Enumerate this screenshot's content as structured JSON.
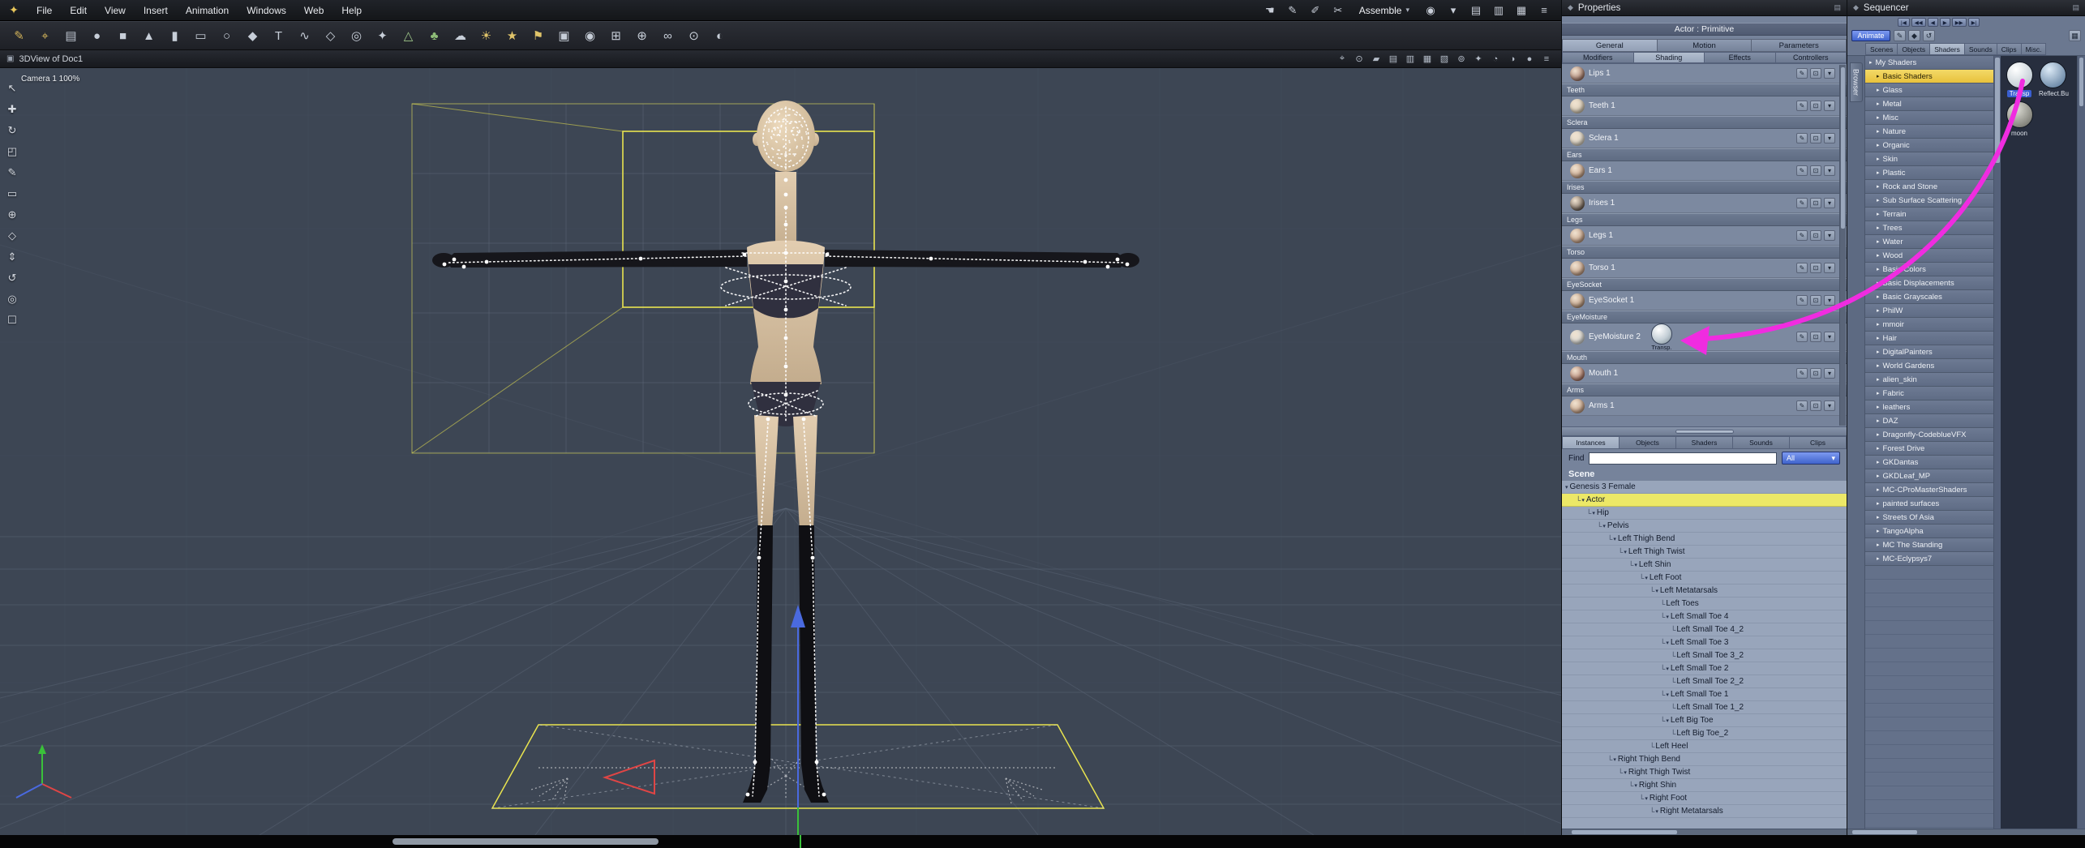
{
  "colors": {
    "accent_magenta": "#f02ce0",
    "selection_yellow": "#ece867",
    "bbox_yellow": "#e9e44f",
    "animate_blue": "#3f63cc",
    "category_selected": "#e8c23c",
    "viewport_bg": "#3d4654"
  },
  "icons": {
    "diamond": "◆",
    "panel_menu": "▤",
    "dropdown": "▾",
    "app_logo": "✦"
  },
  "menu": {
    "items": [
      "File",
      "Edit",
      "View",
      "Insert",
      "Animation",
      "Windows",
      "Web",
      "Help"
    ],
    "right_icons_pre": [
      {
        "name": "hand-tool-icon",
        "glyph": "☚"
      },
      {
        "name": "pen-tool-icon",
        "glyph": "✎"
      },
      {
        "name": "brush-tool-icon",
        "glyph": "✐"
      },
      {
        "name": "knife-tool-icon",
        "glyph": "✂"
      }
    ],
    "right_icons_post": [
      {
        "name": "eye-icon",
        "glyph": "◉"
      },
      {
        "name": "mode-dropdown-icon",
        "glyph": "▾"
      },
      {
        "name": "layout-a-icon",
        "glyph": "▤"
      },
      {
        "name": "layout-b-icon",
        "glyph": "▥"
      },
      {
        "name": "layout-c-icon",
        "glyph": "▦"
      },
      {
        "name": "window-menu-icon",
        "glyph": "≡"
      }
    ]
  },
  "mode": {
    "label": "Assemble"
  },
  "toolbar": {
    "icons": [
      {
        "name": "wireframe-pen-icon",
        "glyph": "✎",
        "color": "#d2b35a"
      },
      {
        "name": "magnet-icon",
        "glyph": "⌖",
        "color": "#d2b35a"
      },
      {
        "name": "layers-icon",
        "glyph": "▤",
        "color": "#b9c0cb"
      },
      {
        "name": "sphere-primitive-icon",
        "glyph": "●",
        "color": "#c7ced8"
      },
      {
        "name": "cube-primitive-icon",
        "glyph": "■",
        "color": "#c7ced8"
      },
      {
        "name": "cone-primitive-icon",
        "glyph": "▲",
        "color": "#c7ced8"
      },
      {
        "name": "cylinder-primitive-icon",
        "glyph": "▮",
        "color": "#c7ced8"
      },
      {
        "name": "plane-primitive-icon",
        "glyph": "▭",
        "color": "#c7ced8"
      },
      {
        "name": "torus-primitive-icon",
        "glyph": "○",
        "color": "#c7ced8"
      },
      {
        "name": "diamond-primitive-icon",
        "glyph": "◆",
        "color": "#c7ced8"
      },
      {
        "name": "text-tool-icon",
        "glyph": "T",
        "color": "#c7ced8"
      },
      {
        "name": "spline-tool-icon",
        "glyph": "∿",
        "color": "#c7ced8"
      },
      {
        "name": "vertex-object-icon",
        "glyph": "◇",
        "color": "#c7ced8"
      },
      {
        "name": "metaball-icon",
        "glyph": "◎",
        "color": "#c7ced8"
      },
      {
        "name": "particle-icon",
        "glyph": "✦",
        "color": "#c7ced8"
      },
      {
        "name": "terrain-icon",
        "glyph": "△",
        "color": "#9fc78a"
      },
      {
        "name": "plant-icon",
        "glyph": "♣",
        "color": "#8fbe78"
      },
      {
        "name": "cloud-icon",
        "glyph": "☁",
        "color": "#c7ced8"
      },
      {
        "name": "sun-light-icon",
        "glyph": "☀",
        "color": "#e0c46a"
      },
      {
        "name": "bulb-light-icon",
        "glyph": "★",
        "color": "#e0c46a"
      },
      {
        "name": "spot-light-icon",
        "glyph": "⚑",
        "color": "#e0c46a"
      },
      {
        "name": "camera-icon",
        "glyph": "▣",
        "color": "#c7ced8"
      },
      {
        "name": "target-camera-icon",
        "glyph": "◉",
        "color": "#c7ced8"
      },
      {
        "name": "group-icon",
        "glyph": "⊞",
        "color": "#c7ced8"
      },
      {
        "name": "hotpoint-icon",
        "glyph": "⊕",
        "color": "#c7ced8"
      },
      {
        "name": "link-icon",
        "glyph": "∞",
        "color": "#c7ced8"
      },
      {
        "name": "physics-icon",
        "glyph": "⊙",
        "color": "#c7ced8"
      },
      {
        "name": "render-icon",
        "glyph": "◐",
        "color": "#c7ced8"
      }
    ]
  },
  "viewport": {
    "title": "3DView of Doc1",
    "camera_label": "Camera 1 100%",
    "titlebar_icon": {
      "name": "viewport-icon",
      "glyph": "▣"
    },
    "right_icons": [
      {
        "name": "production-frame-icon",
        "glyph": "⌖"
      },
      {
        "name": "preview-quality-icon",
        "glyph": "⊙"
      },
      {
        "name": "split-pane-icon",
        "glyph": "▰"
      },
      {
        "name": "layout-single-icon",
        "glyph": "▤"
      },
      {
        "name": "layout-two-icon",
        "glyph": "▥"
      },
      {
        "name": "layout-three-icon",
        "glyph": "▦"
      },
      {
        "name": "layout-four-icon",
        "glyph": "▧"
      },
      {
        "name": "camera-sphere-icon",
        "glyph": "⊚"
      },
      {
        "name": "effects-icon",
        "glyph": "✦"
      },
      {
        "name": "wireframe-mode-icon",
        "glyph": "◔"
      },
      {
        "name": "gouraud-mode-icon",
        "glyph": "◑"
      },
      {
        "name": "textured-mode-icon",
        "glyph": "●"
      },
      {
        "name": "viewport-options-icon",
        "glyph": "≡"
      }
    ],
    "left_tools": [
      {
        "name": "select-tool-icon",
        "glyph": "↖"
      },
      {
        "name": "universal-manipulator-icon",
        "glyph": "✚"
      },
      {
        "name": "rotate-tool-icon",
        "glyph": "↻"
      },
      {
        "name": "scale-tool-icon",
        "glyph": "◰"
      },
      {
        "name": "eyedropper-icon",
        "glyph": "✎"
      },
      {
        "name": "region-render-icon",
        "glyph": "▭"
      },
      {
        "name": "camera-dolly-icon",
        "glyph": "⊕"
      },
      {
        "name": "camera-pan-icon",
        "glyph": "◇"
      },
      {
        "name": "camera-track-icon",
        "glyph": "⇕"
      },
      {
        "name": "camera-bank-icon",
        "glyph": "↺"
      },
      {
        "name": "zoom-tool-icon",
        "glyph": "◎"
      },
      {
        "name": "hand-tool-icon",
        "glyph": "☐"
      }
    ]
  },
  "properties": {
    "title": "Properties",
    "subtitle": "Actor : Primitive",
    "tabs": [
      "General",
      "Motion",
      "Parameters"
    ],
    "active_tab": "General",
    "subtabs": [
      "Modifiers",
      "Shading",
      "Effects",
      "Controllers"
    ],
    "active_subtab": "Shading",
    "row_icons": [
      {
        "name": "edit-shader-icon",
        "glyph": "✎"
      },
      {
        "name": "detach-shader-icon",
        "glyph": "⊡"
      },
      {
        "name": "shader-menu-ic",
        "glyph": "▾"
      }
    ],
    "shading_rows": [
      {
        "group": "",
        "item": "Lips 1",
        "thumb": "#8a5444"
      },
      {
        "group": "Teeth",
        "item": "Teeth 1",
        "thumb": "#cfc4ae"
      },
      {
        "group": "Sclera",
        "item": "Sclera 1",
        "thumb": "#d6d2c4"
      },
      {
        "group": "Ears",
        "item": "Ears 1",
        "thumb": "#b5886a"
      },
      {
        "group": "Irises",
        "item": "Irises 1",
        "thumb": "#46372c"
      },
      {
        "group": "Legs",
        "item": "Legs 1",
        "thumb": "#b5886a"
      },
      {
        "group": "Torso",
        "item": "Torso 1",
        "thumb": "#b5886a"
      },
      {
        "group": "EyeSocket",
        "item": "EyeSocket 1",
        "thumb": "#a67c5e"
      },
      {
        "group": "EyeMoisture",
        "item": "EyeMoisture 2",
        "thumb": "#ccd4d9",
        "extra": "Transp."
      },
      {
        "group": "Mouth",
        "item": "Mouth 1",
        "thumb": "#93503f"
      },
      {
        "group": "Arms",
        "item": "Arms 1",
        "thumb": "#b5886a"
      }
    ],
    "bottom_tabs": [
      "Instances",
      "Objects",
      "Shaders",
      "Sounds",
      "Clips"
    ],
    "active_bottom_tab": "Instances",
    "find_label": "Find",
    "find_value": "",
    "filter_value": "All",
    "tree_header": "Scene",
    "tree": [
      {
        "label": "Genesis 3 Female",
        "depth": 0,
        "branch": true
      },
      {
        "label": "Actor",
        "depth": 1,
        "branch": true,
        "selected": true
      },
      {
        "label": "Hip",
        "depth": 2,
        "branch": true
      },
      {
        "label": "Pelvis",
        "depth": 3,
        "branch": true
      },
      {
        "label": "Left Thigh Bend",
        "depth": 4,
        "branch": true
      },
      {
        "label": "Left Thigh Twist",
        "depth": 5,
        "branch": true
      },
      {
        "label": "Left Shin",
        "depth": 6,
        "branch": true
      },
      {
        "label": "Left Foot",
        "depth": 7,
        "branch": true
      },
      {
        "label": "Left Metatarsals",
        "depth": 8,
        "branch": true
      },
      {
        "label": "Left Toes",
        "depth": 9,
        "branch": false
      },
      {
        "label": "Left Small Toe 4",
        "depth": 9,
        "branch": true
      },
      {
        "label": "Left Small Toe 4_2",
        "depth": 10,
        "branch": false
      },
      {
        "label": "Left Small Toe 3",
        "depth": 9,
        "branch": true
      },
      {
        "label": "Left Small Toe 3_2",
        "depth": 10,
        "branch": false
      },
      {
        "label": "Left Small Toe 2",
        "depth": 9,
        "branch": true
      },
      {
        "label": "Left Small Toe 2_2",
        "depth": 10,
        "branch": false
      },
      {
        "label": "Left Small Toe 1",
        "depth": 9,
        "branch": true
      },
      {
        "label": "Left Small Toe 1_2",
        "depth": 10,
        "branch": false
      },
      {
        "label": "Left Big Toe",
        "depth": 9,
        "branch": true
      },
      {
        "label": "Left Big Toe_2",
        "depth": 10,
        "branch": false
      },
      {
        "label": "Left Heel",
        "depth": 8,
        "branch": false
      },
      {
        "label": "Right Thigh Bend",
        "depth": 4,
        "branch": true
      },
      {
        "label": "Right Thigh Twist",
        "depth": 5,
        "branch": true
      },
      {
        "label": "Right Shin",
        "depth": 6,
        "branch": true
      },
      {
        "label": "Right Foot",
        "depth": 7,
        "branch": true
      },
      {
        "label": "Right Metatarsals",
        "depth": 8,
        "branch": true
      }
    ]
  },
  "sequencer": {
    "title": "Sequencer",
    "animate_label": "Animate",
    "transport": [
      "|◀",
      "◀◀",
      "◀",
      "▶",
      "▶▶",
      "▶|"
    ],
    "row2_icons": [
      {
        "name": "keyframe-icon",
        "glyph": "✎"
      },
      {
        "name": "marker-icon",
        "glyph": "◆"
      },
      {
        "name": "loop-icon",
        "glyph": "↺"
      }
    ],
    "grid_icon": {
      "name": "grid-icon",
      "glyph": "▦"
    },
    "tabs": [
      "Scenes",
      "Objects",
      "Shaders",
      "Sounds",
      "Clips",
      "Misc."
    ],
    "active_tab": "Shaders",
    "side_tab": "Browser",
    "categories": [
      {
        "label": "My Shaders",
        "depth": 0
      },
      {
        "label": "Basic Shaders",
        "depth": 1,
        "selected": true
      },
      {
        "label": "Glass",
        "depth": 1
      },
      {
        "label": "Metal",
        "depth": 1
      },
      {
        "label": "Misc",
        "depth": 1
      },
      {
        "label": "Nature",
        "depth": 1
      },
      {
        "label": "Organic",
        "depth": 1
      },
      {
        "label": "Skin",
        "depth": 1
      },
      {
        "label": "Plastic",
        "depth": 1
      },
      {
        "label": "Rock and Stone",
        "depth": 1
      },
      {
        "label": "Sub Surface Scattering",
        "depth": 1
      },
      {
        "label": "Terrain",
        "depth": 1
      },
      {
        "label": "Trees",
        "depth": 1
      },
      {
        "label": "Water",
        "depth": 1
      },
      {
        "label": "Wood",
        "depth": 1
      },
      {
        "label": "Basic Colors",
        "depth": 1
      },
      {
        "label": "Basic Displacements",
        "depth": 1
      },
      {
        "label": "Basic Grayscales",
        "depth": 1
      },
      {
        "label": "PhilW",
        "depth": 1
      },
      {
        "label": "mmoir",
        "depth": 1
      },
      {
        "label": "Hair",
        "depth": 1
      },
      {
        "label": "DigitalPainters",
        "depth": 1
      },
      {
        "label": "World Gardens",
        "depth": 1
      },
      {
        "label": "alien_skin",
        "depth": 1
      },
      {
        "label": "Fabric",
        "depth": 1
      },
      {
        "label": "leathers",
        "depth": 1
      },
      {
        "label": "DAZ",
        "depth": 1
      },
      {
        "label": "Dragonfly-CodeblueVFX",
        "depth": 1
      },
      {
        "label": "Forest Drive",
        "depth": 1
      },
      {
        "label": "GKDantas",
        "depth": 1
      },
      {
        "label": "GKDLeaf_MP",
        "depth": 1
      },
      {
        "label": "MC-CProMasterShaders",
        "depth": 1
      },
      {
        "label": "painted surfaces",
        "depth": 1
      },
      {
        "label": "Streets Of Asia",
        "depth": 1
      },
      {
        "label": "TangoAlpha",
        "depth": 1
      },
      {
        "label": "MC The Standing",
        "depth": 1
      },
      {
        "label": "MC-Eclypsys7",
        "depth": 1
      }
    ],
    "thumbnails": [
      {
        "label": "Transp",
        "selected": true,
        "hi": "#ffffff",
        "lo": "#aebcc6"
      },
      {
        "label": "Reflect.Bump...",
        "selected": false,
        "hi": "#dceaf6",
        "lo": "#4d6e92"
      },
      {
        "label": "moon",
        "selected": false,
        "hi": "#e2e2da",
        "lo": "#62625a"
      }
    ]
  }
}
